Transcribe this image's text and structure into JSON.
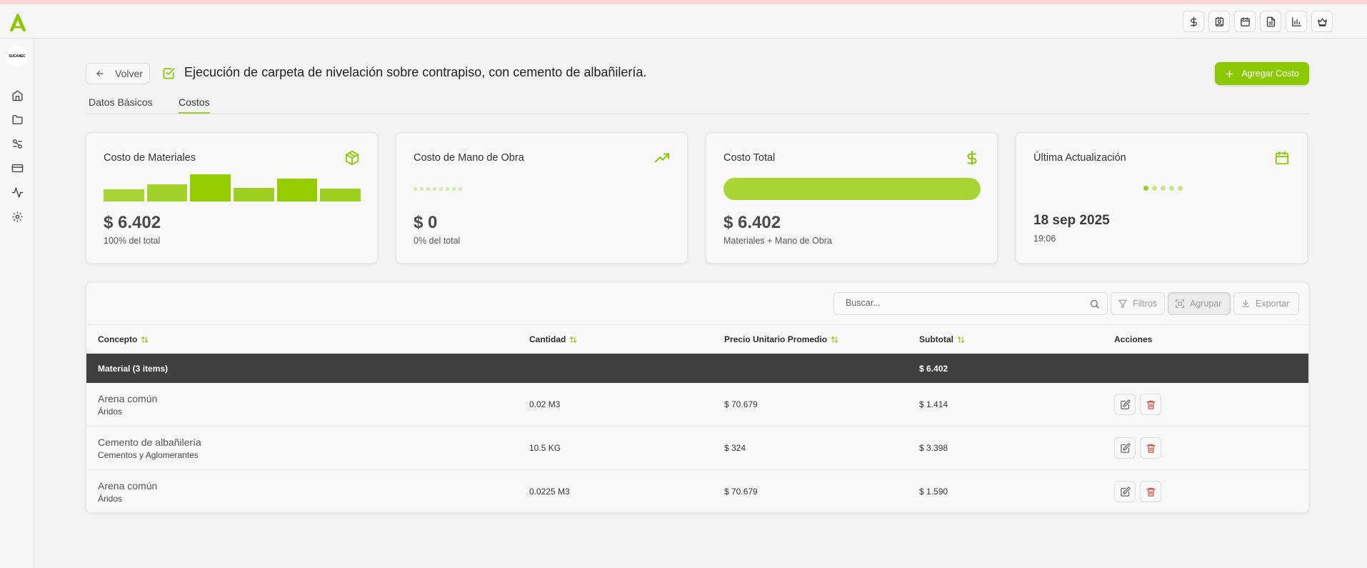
{
  "brand": {
    "avatar_text": "SUCANEC"
  },
  "topbar": {
    "icons": [
      "dollar-icon",
      "contact-icon",
      "calendar-icon",
      "document-icon",
      "chart-icon",
      "crown-icon"
    ]
  },
  "sidebar": {
    "icons": [
      "home-icon",
      "folder-icon",
      "tools-icon",
      "card-icon",
      "activity-icon",
      "settings-icon"
    ]
  },
  "header": {
    "back_label": "Volver",
    "title": "Ejecución de carpeta de nivelación sobre contrapiso, con cemento de albañilería.",
    "add_label": "Agregar Costo"
  },
  "tabs": [
    {
      "label": "Datos Básicos",
      "active": false
    },
    {
      "label": "Costos",
      "active": true
    }
  ],
  "colors": {
    "accent": "#8cc800",
    "accent_light": "#a9d534",
    "group_row": "#3f3f3f",
    "delete": "#e0443e"
  },
  "cards": {
    "materials": {
      "title": "Costo de Materiales",
      "value": "$ 6.402",
      "sub": "100% del total",
      "bar_levels": [
        0.45,
        0.62,
        1.0,
        0.5,
        0.85,
        0.47
      ]
    },
    "labor": {
      "title": "Costo de Mano de Obra",
      "value": "$ 0",
      "sub": "0% del total"
    },
    "total": {
      "title": "Costo Total",
      "value": "$ 6.402",
      "sub": "Materiales + Mano de Obra",
      "fill": 1.0
    },
    "updated": {
      "title": "Última Actualización",
      "date": "18 sep 2025",
      "time": "19:06"
    }
  },
  "toolbar": {
    "search_placeholder": "Buscar...",
    "filters_label": "Filtros",
    "group_label": "Agrupar",
    "export_label": "Exportar"
  },
  "table": {
    "columns": [
      "Concepto",
      "Cantidad",
      "Precio Unitario Promedio",
      "Subtotal",
      "Acciones"
    ],
    "group": {
      "label": "Material (3 items)",
      "subtotal": "$ 6.402"
    },
    "rows": [
      {
        "name": "Arena común",
        "category": "Áridos",
        "quantity": "0.02 M3",
        "unit_price": "$ 70.679",
        "subtotal": "$ 1.414"
      },
      {
        "name": "Cemento de albañilería",
        "category": "Cementos y Aglomerantes",
        "quantity": "10.5 KG",
        "unit_price": "$ 324",
        "subtotal": "$ 3.398"
      },
      {
        "name": "Arena común",
        "category": "Áridos",
        "quantity": "0.0225 M3",
        "unit_price": "$ 70.679",
        "subtotal": "$ 1.590"
      }
    ]
  }
}
